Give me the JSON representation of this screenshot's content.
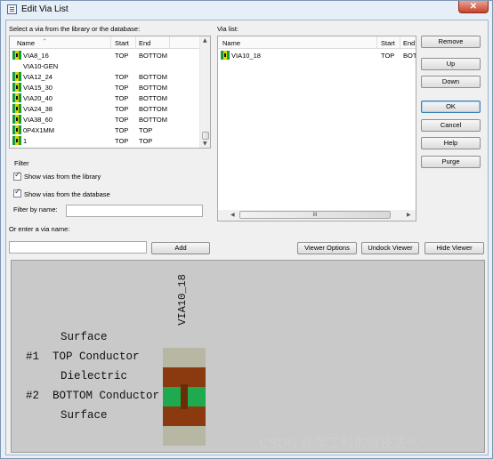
{
  "window": {
    "title": "Edit Via List",
    "close_glyph": "✕"
  },
  "library": {
    "label": "Select a via from the library or the database:",
    "columns": [
      "Name",
      "Start",
      "End"
    ],
    "rows": [
      {
        "name": "VIA8_16",
        "start": "TOP",
        "end": "BOTTOM",
        "icon": "via-icon"
      },
      {
        "name": "VIA10-GEN",
        "start": "",
        "end": "",
        "icon": ""
      },
      {
        "name": "VIA12_24",
        "start": "TOP",
        "end": "BOTTOM",
        "icon": "via-icon"
      },
      {
        "name": "VIA15_30",
        "start": "TOP",
        "end": "BOTTOM",
        "icon": "via-icon"
      },
      {
        "name": "VIA20_40",
        "start": "TOP",
        "end": "BOTTOM",
        "icon": "via-icon"
      },
      {
        "name": "VIA24_38",
        "start": "TOP",
        "end": "BOTTOM",
        "icon": "via-icon"
      },
      {
        "name": "VIA38_60",
        "start": "TOP",
        "end": "BOTTOM",
        "icon": "via-icon"
      },
      {
        "name": "0P4X1MM",
        "start": "TOP",
        "end": "TOP",
        "icon": "via-icon"
      },
      {
        "name": "1",
        "start": "TOP",
        "end": "TOP",
        "icon": "via-icon"
      }
    ]
  },
  "via_list": {
    "label": "Via list:",
    "columns": [
      "Name",
      "Start",
      "End"
    ],
    "rows": [
      {
        "name": "VIA10_18",
        "start": "TOP",
        "end": "BOT",
        "icon": "via-icon"
      }
    ],
    "hscroll_grip": "III"
  },
  "side_buttons": {
    "remove": "Remove",
    "up": "Up",
    "down": "Down",
    "ok": "OK",
    "cancel": "Cancel",
    "help": "Help",
    "purge": "Purge"
  },
  "filter": {
    "title": "Filter",
    "show_library": "Show vias from the library",
    "show_database": "Show vias from the database",
    "show_library_checked": true,
    "show_database_checked": true,
    "filter_by_name_label": "Filter by name:",
    "filter_by_name_value": ""
  },
  "enter": {
    "label": "Or enter a via name:",
    "value": "",
    "add_button": "Add"
  },
  "viewer_buttons": {
    "options": "Viewer Options",
    "undock": "Undock Viewer",
    "hide": "Hide Viewer"
  },
  "viewer": {
    "via_name": "VIA10_18",
    "layers": [
      {
        "num": "",
        "text": "Surface"
      },
      {
        "num": "#1",
        "text": "TOP Conductor"
      },
      {
        "num": "",
        "text": "Dielectric"
      },
      {
        "num": "#2",
        "text": "BOTTOM Conductor"
      },
      {
        "num": "",
        "text": "Surface"
      }
    ],
    "colors": {
      "conductor": "#8b3a0f",
      "dielectric": "#1faa4f",
      "surface": "#b7b7a4",
      "barrel": "#6b2c08"
    }
  },
  "watermark": "CSDN @学工科的皮皮志^_^"
}
